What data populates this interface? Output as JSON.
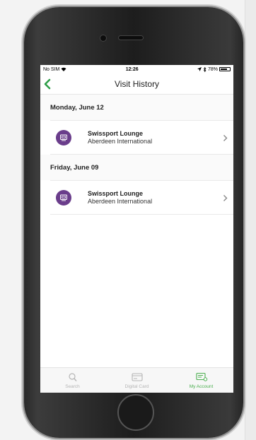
{
  "status_bar": {
    "carrier": "No SIM",
    "wifi_icon": "wifi-icon",
    "time": "12:26",
    "battery_percent": "78%",
    "battery_level": 0.78
  },
  "nav": {
    "title": "Visit History",
    "back_icon": "chevron-left-icon"
  },
  "visits": [
    {
      "date": "Monday, June 12",
      "lounge_name": "Swissport  Lounge",
      "airport": "Aberdeen International"
    },
    {
      "date": "Friday, June 09",
      "lounge_name": "Swissport  Lounge",
      "airport": "Aberdeen International"
    }
  ],
  "tabs": [
    {
      "label": "Search",
      "icon": "search-icon",
      "active": false
    },
    {
      "label": "Digital Card",
      "icon": "card-icon",
      "active": false
    },
    {
      "label": "My Account",
      "icon": "account-icon",
      "active": true
    }
  ],
  "colors": {
    "accent_green": "#2e9e48",
    "lounge_purple": "#6a3d8b",
    "active_tab": "#4caf50"
  }
}
